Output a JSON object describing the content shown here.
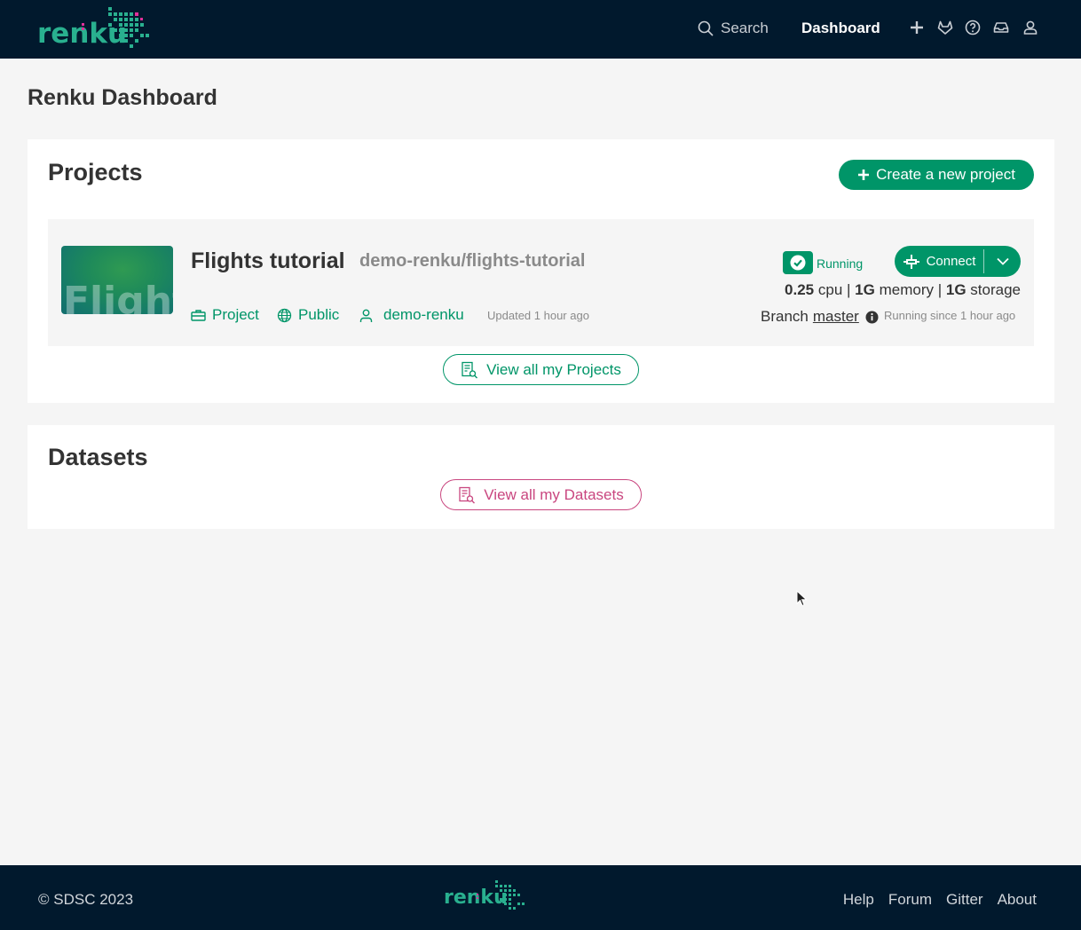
{
  "header": {
    "logo_text": "renku",
    "search_label": "Search",
    "dashboard_label": "Dashboard",
    "icons": [
      "plus-icon",
      "gitlab-icon",
      "help-icon",
      "inbox-icon",
      "user-icon"
    ]
  },
  "page": {
    "title": "Renku Dashboard"
  },
  "projects": {
    "heading": "Projects",
    "create_label": "Create a new project",
    "items": [
      {
        "thumbnail_text": "Flight",
        "title": "Flights tutorial",
        "slug": "demo-renku/flights-tutorial",
        "type": "Project",
        "visibility": "Public",
        "owner": "demo-renku",
        "updated": "Updated 1 hour ago",
        "session": {
          "status": "Running",
          "connect_label": "Connect",
          "cpu": "0.25",
          "cpu_unit": "cpu",
          "memory": "1G",
          "memory_unit": "memory",
          "storage": "1G",
          "storage_unit": "storage",
          "branch_prefix": "Branch",
          "branch": "master",
          "running_since": "Running since 1 hour ago"
        }
      }
    ],
    "view_all_label": "View all my Projects"
  },
  "datasets": {
    "heading": "Datasets",
    "view_all_label": "View all my Datasets"
  },
  "footer": {
    "copyright": "© SDSC 2023",
    "logo_text": "renku",
    "links": [
      "Help",
      "Forum",
      "Gitter",
      "About"
    ]
  },
  "colors": {
    "navbar": "#01192d",
    "primary": "#009568",
    "dataset_accent": "#c9467f",
    "background": "#f5f5f5"
  }
}
